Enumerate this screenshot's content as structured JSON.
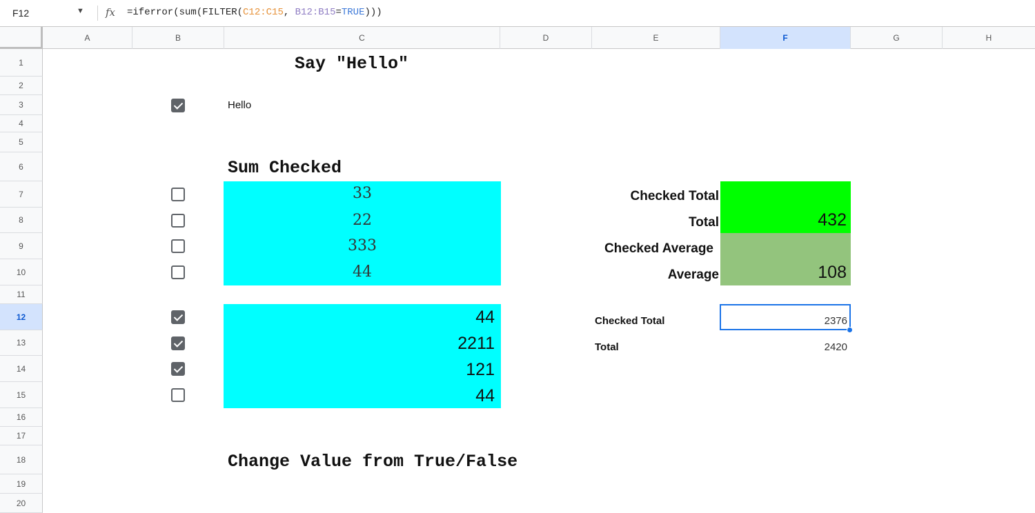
{
  "formula_bar": {
    "cell_ref": "F12",
    "formula_prefix": "=iferror(sum(FILTER(",
    "formula_range1": "C12:C15",
    "formula_mid": ", ",
    "formula_range2": "B12:B15",
    "formula_eq": "=",
    "formula_true": "TRUE",
    "formula_suffix": ")))"
  },
  "columns": [
    "A",
    "B",
    "C",
    "D",
    "E",
    "F",
    "G",
    "H"
  ],
  "rows": [
    "1",
    "2",
    "3",
    "4",
    "5",
    "6",
    "7",
    "8",
    "9",
    "10",
    "11",
    "12",
    "13",
    "14",
    "15",
    "16",
    "17",
    "18",
    "19",
    "20"
  ],
  "sheet": {
    "title_hello": "Say \"Hello\"",
    "hello_text": "Hello",
    "title_sum": "Sum Checked",
    "title_change": "Change Value from True/False",
    "group1_values": [
      "33",
      "22",
      "333",
      "44"
    ],
    "group1_checked": [
      false,
      false,
      false,
      false
    ],
    "group2_values": [
      "44",
      "2211",
      "121",
      "44"
    ],
    "group2_checked": [
      true,
      true,
      true,
      false
    ],
    "hello_checked": true,
    "summary_big": {
      "checked_total_label": "Checked Total",
      "total_label": "Total",
      "total_value": "432",
      "checked_average_label": "Checked Average",
      "average_label": "Average",
      "average_value": "108"
    },
    "summary_small": {
      "checked_total_label": "Checked Total",
      "checked_total_value": "2376",
      "total_label": "Total",
      "total_value": "2420"
    }
  },
  "colors": {
    "cyan": "#00ffff",
    "green": "#00ff00",
    "olive_green": "#93c47d",
    "selection_blue": "#1a73e8"
  }
}
